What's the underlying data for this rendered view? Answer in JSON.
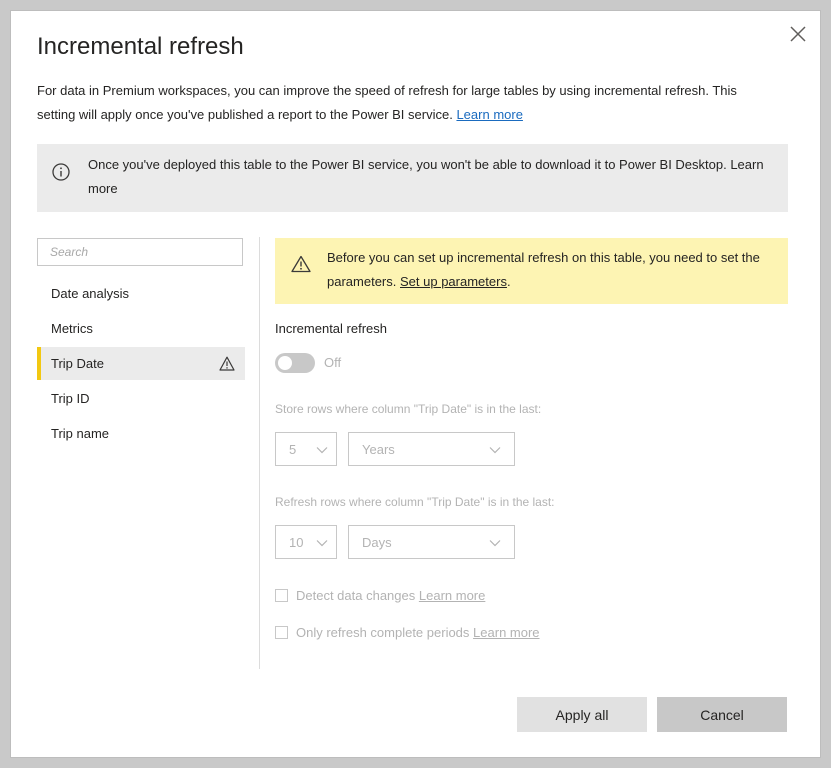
{
  "dialog": {
    "title": "Incremental refresh",
    "description": "For data in Premium workspaces, you can improve the speed of refresh for large tables by using incremental refresh. This setting will apply once you've published a report to the Power BI service.",
    "description_link": "Learn more",
    "info_banner": "Once you've deployed this table to the Power BI service, you won't be able to download it to Power BI Desktop. Learn more"
  },
  "sidebar": {
    "search_placeholder": "Search",
    "items": [
      {
        "label": "Date analysis"
      },
      {
        "label": "Metrics"
      },
      {
        "label": "Trip Date",
        "selected": true,
        "warning": true
      },
      {
        "label": "Trip ID"
      },
      {
        "label": "Trip name"
      }
    ]
  },
  "warning_banner": {
    "text": "Before you can set up incremental refresh on this table, you need to set the parameters.",
    "link": "Set up parameters",
    "suffix": "."
  },
  "settings": {
    "section_label": "Incremental refresh",
    "toggle_state": "Off",
    "store_label": "Store rows where column \"Trip Date\" is in the last:",
    "store_number": "5",
    "store_unit": "Years",
    "refresh_label": "Refresh rows where column \"Trip Date\" is in the last:",
    "refresh_number": "10",
    "refresh_unit": "Days",
    "detect_label": "Detect data changes",
    "detect_link": "Learn more",
    "complete_label": "Only refresh complete periods",
    "complete_link": "Learn more"
  },
  "footer": {
    "apply_label": "Apply all",
    "cancel_label": "Cancel"
  },
  "colors": {
    "accent": "#f2c811",
    "warning_bg": "#fdf4b3",
    "info_bg": "#ebebeb",
    "link": "#1a6bbf"
  },
  "icons": [
    "close-icon",
    "info-icon",
    "warning-icon",
    "chevron-down-icon"
  ]
}
